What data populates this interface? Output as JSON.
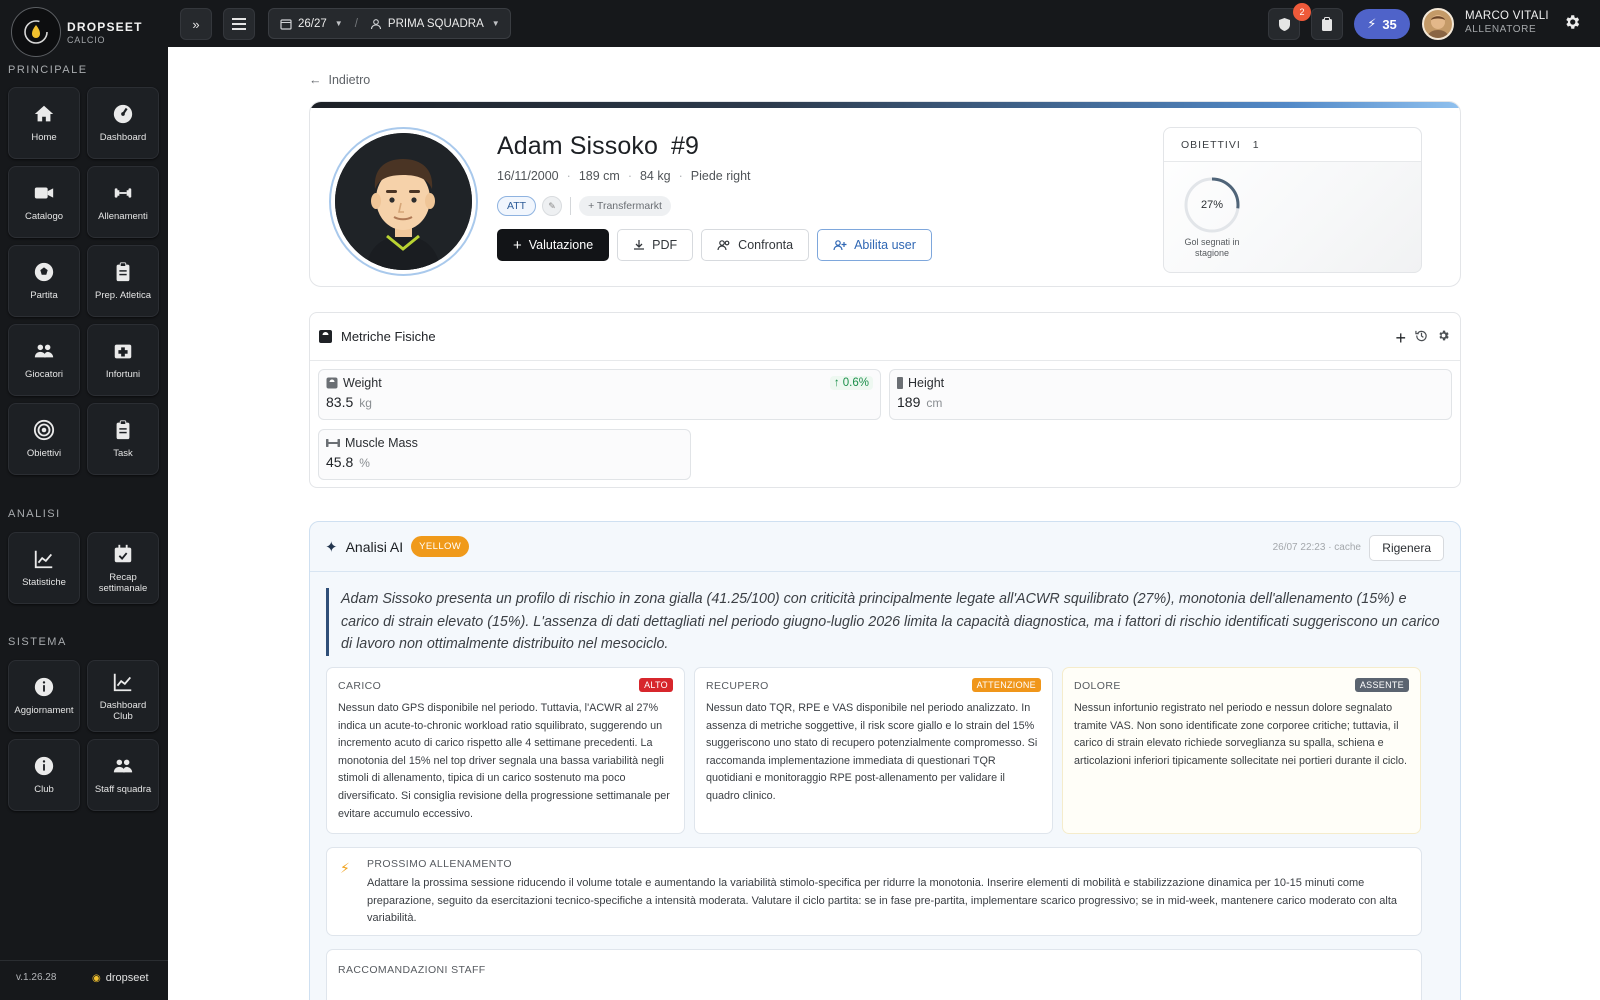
{
  "brand": {
    "name": "DROPSEET",
    "sub": "CALCIO"
  },
  "sidebar": {
    "sections": [
      {
        "title": "PRINCIPALE",
        "items": [
          {
            "label": "Home",
            "icon": "home-icon"
          },
          {
            "label": "Dashboard",
            "icon": "dashboard-icon"
          },
          {
            "label": "Catalogo",
            "icon": "video-icon"
          },
          {
            "label": "Allenamenti",
            "icon": "dumbbell-icon"
          },
          {
            "label": "Partita",
            "icon": "ball-icon"
          },
          {
            "label": "Prep. Atletica",
            "icon": "clipboard-icon"
          },
          {
            "label": "Giocatori",
            "icon": "users-icon"
          },
          {
            "label": "Infortuni",
            "icon": "medkit-icon"
          },
          {
            "label": "Obiettivi",
            "icon": "target-icon"
          },
          {
            "label": "Task",
            "icon": "clipboard-icon"
          }
        ]
      },
      {
        "title": "ANALISI",
        "items": [
          {
            "label": "Statistiche",
            "icon": "chart-icon"
          },
          {
            "label": "Recap settimanale",
            "icon": "calendar-check-icon"
          }
        ]
      },
      {
        "title": "SISTEMA",
        "items": [
          {
            "label": "Aggiornament",
            "icon": "info-icon"
          },
          {
            "label": "Dashboard Club",
            "icon": "chart-icon"
          },
          {
            "label": "Club",
            "icon": "info-icon"
          },
          {
            "label": "Staff squadra",
            "icon": "users-icon"
          }
        ]
      }
    ],
    "version": "v.1.26.28",
    "footer_brand": "dropseet"
  },
  "topbar": {
    "expand_label": "»",
    "season": "26/27",
    "team": "PRIMA SQUADRA",
    "notifications_count": "2",
    "credits": "35",
    "user_name": "MARCO VITALI",
    "user_role": "ALLENATORE"
  },
  "back_label": "Indietro",
  "player": {
    "name": "Adam Sissoko",
    "number": "#9",
    "birth": "16/11/2000",
    "height": "189 cm",
    "weight": "84 kg",
    "foot": "Piede right",
    "role": "ATT",
    "transfermarkt": "+ Transfermarkt",
    "actions": {
      "valutazione": "Valutazione",
      "pdf": "PDF",
      "confronta": "Confronta",
      "abilita": "Abilita user"
    }
  },
  "objectives": {
    "title": "OBIETTIVI",
    "count": "1",
    "percent_label": "27%",
    "progress": 0.27,
    "label": "Gol segnati in stagione"
  },
  "metrics": {
    "title": "Metriche Fisiche",
    "items": [
      {
        "label": "Weight",
        "value": "83.5",
        "unit": "kg",
        "delta": "0.6%"
      },
      {
        "label": "Height",
        "value": "189",
        "unit": "cm"
      },
      {
        "label": "Muscle Mass",
        "value": "45.8",
        "unit": "%"
      }
    ]
  },
  "ai": {
    "title": "Analisi AI",
    "level": "YELLOW",
    "cache": "26/07 22:23 · cache",
    "regen": "Rigenera",
    "summary": "Adam Sissoko presenta un profilo di rischio in zona gialla (41.25/100) con criticità principalmente legate all'ACWR squilibrato (27%), monotonia dell'allenamento (15%) e carico di strain elevato (15%). L'assenza di dati dettagliati nel periodo giugno-luglio 2026 limita la capacità diagnostica, ma i fattori di rischio identificati suggeriscono un carico di lavoro non ottimalmente distribuito nel mesociclo.",
    "boxes": [
      {
        "title": "CARICO",
        "badge": "ALTO",
        "badge_color": "#d7262c",
        "text": "Nessun dato GPS disponibile nel periodo. Tuttavia, l'ACWR al 27% indica un acute-to-chronic workload ratio squilibrato, suggerendo un incremento acuto di carico rispetto alle 4 settimane precedenti. La monotonia del 15% nel top driver segnala una bassa variabilità negli stimoli di allenamento, tipica di un carico sostenuto ma poco diversificato. Si consiglia revisione della progressione settimanale per evitare accumulo eccessivo."
      },
      {
        "title": "RECUPERO",
        "badge": "ATTENZIONE",
        "badge_color": "#f0961a",
        "text": "Nessun dato TQR, RPE e VAS disponibile nel periodo analizzato. In assenza di metriche soggettive, il risk score giallo e lo strain del 15% suggeriscono uno stato di recupero potenzialmente compromesso. Si raccomanda implementazione immediata di questionari TQR quotidiani e monitoraggio RPE post-allenamento per validare il quadro clinico."
      },
      {
        "title": "DOLORE",
        "badge": "ASSENTE",
        "badge_color": "#5b6470",
        "text": "Nessun infortunio registrato nel periodo e nessun dolore segnalato tramite VAS. Non sono identificate zone corporee critiche; tuttavia, il carico di strain elevato richiede sorveglianza su spalla, schiena e articolazioni inferiori tipicamente sollecitate nei portieri durante il ciclo."
      }
    ],
    "next_title": "PROSSIMO ALLENAMENTO",
    "next_text": "Adattare la prossima sessione riducendo il volume totale e aumentando la variabilità stimolo-specifica per ridurre la monotonia. Inserire elementi di mobilità e stabilizzazione dinamica per 10-15 minuti come preparazione, seguito da esercitazioni tecnico-specifiche a intensità moderata. Valutare il ciclo partita: se in fase pre-partita, implementare scarico progressivo; se in mid-week, mantenere carico moderato con alta variabilità.",
    "staff_title": "RACCOMANDAZIONI STAFF"
  }
}
